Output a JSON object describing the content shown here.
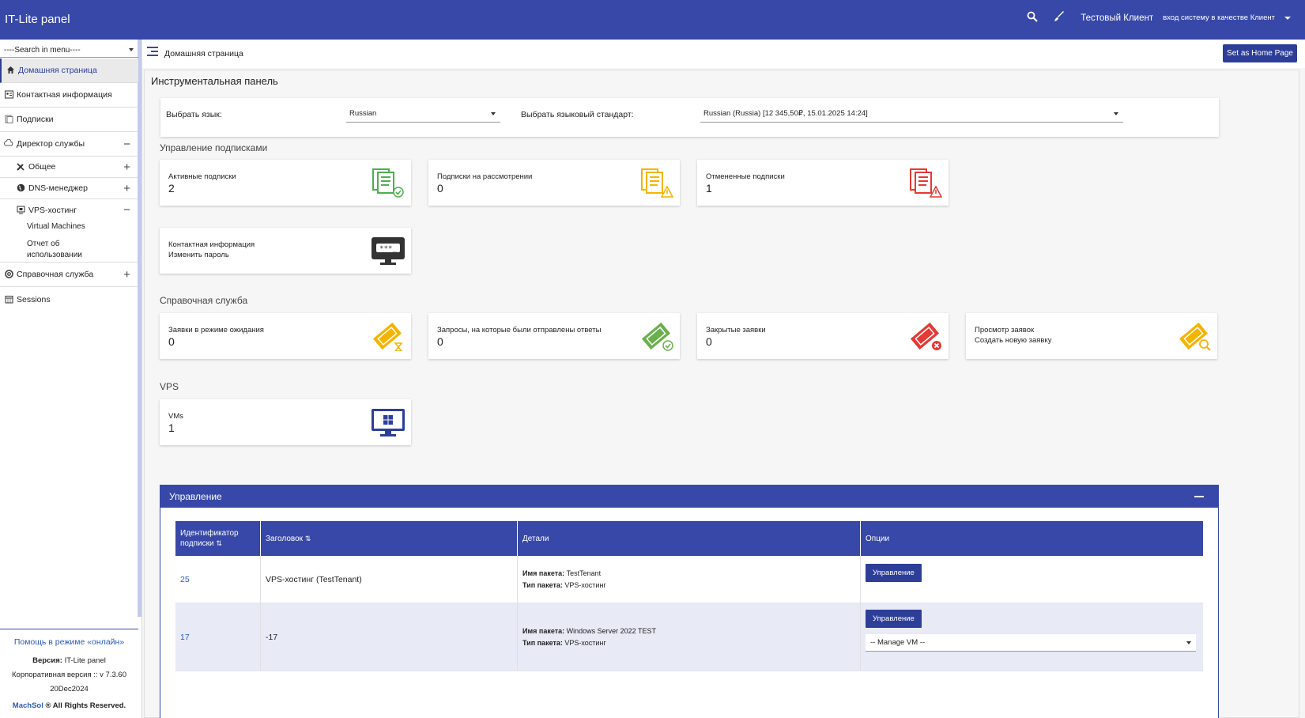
{
  "header": {
    "brand": "IT-Lite panel",
    "user_name": "Тестовый Клиент",
    "login_as": "вход систему в качестве Клиент",
    "icons": [
      "search-icon",
      "brush-icon",
      "chevron-down-icon"
    ]
  },
  "sidebar": {
    "search_placeholder": "----Search in menu----",
    "items": [
      {
        "label": "Домашняя страница",
        "icon": "home-icon"
      },
      {
        "label": "Контактная информация",
        "icon": "contact-card-icon"
      },
      {
        "label": "Подписки",
        "icon": "subscriptions-icon"
      },
      {
        "label": "Директор службы",
        "icon": "cloud-icon",
        "toggle": "−"
      },
      {
        "label": "Общее",
        "icon": "tools-icon",
        "toggle": "+"
      },
      {
        "label": "DNS-менеджер",
        "icon": "globe-icon",
        "toggle": "+"
      },
      {
        "label": "VPS-хостинг",
        "icon": "monitor-icon",
        "toggle": "−"
      },
      {
        "label": "Справочная служба",
        "icon": "lifebuoy-icon",
        "toggle": "+"
      },
      {
        "label": "Sessions",
        "icon": "calendar-icon"
      }
    ],
    "vps_children": [
      "Virtual Machines",
      "Отчет об использовании"
    ],
    "help_link": "Помощь в режиме «онлайн»",
    "version_label": "Версия:",
    "version_product": "IT-Lite panel",
    "version_line2": "Корпоративная версия :: v 7.3.60",
    "version_date": "20Dec2024",
    "copyright_brand": "MachSol",
    "copyright_text": "® All Rights Reserved."
  },
  "breadcrumb": {
    "current": "Домашняя страница",
    "home_button": "Set as Home Page"
  },
  "dashboard": {
    "title": "Инструментальная панель",
    "lang_label": "Выбрать язык:",
    "lang_value": "Russian",
    "locale_label": "Выбрать языковый стандарт:",
    "locale_value": "Russian (Russia) [12 345,50₽, 15.01.2025 14:24]",
    "subscriptions_section": "Управление подписками",
    "subscriptions": [
      {
        "title": "Активные подписки",
        "value": "2",
        "color": "#4caf50"
      },
      {
        "title": "Подписки на рассмотрении",
        "value": "0",
        "color": "#f5b400"
      },
      {
        "title": "Отмененные подписки",
        "value": "1",
        "color": "#e53935"
      }
    ],
    "contact_card": {
      "line1": "Контактная информация",
      "line2": "Изменить пароль"
    },
    "helpdesk_section": "Справочная служба",
    "helpdesk": [
      {
        "title": "Заявки в режиме ожидания",
        "value": "0",
        "color": "#f5b400"
      },
      {
        "title": "Запросы, на которые были отправлены ответы",
        "value": "0",
        "color": "#6ab04c"
      },
      {
        "title": "Закрытые заявки",
        "value": "0",
        "color": "#e53935"
      }
    ],
    "helpdesk_view": {
      "line1": "Просмотр заявок",
      "line2": "Создать новую заявку"
    },
    "vps_section": "VPS",
    "vms": {
      "title": "VMs",
      "value": "1"
    }
  },
  "management": {
    "title": "Управление",
    "columns": [
      "Идентификатор подписки",
      "Заголовок",
      "Детали",
      "Опции"
    ],
    "sort_glyph": "⇅",
    "pkg_name_label": "Имя пакета:",
    "pkg_type_label": "Тип пакета:",
    "rows": [
      {
        "id": "25",
        "title": "VPS-хостинг (TestTenant)",
        "pkg_name": "TestTenant",
        "pkg_type": "VPS-хостинг",
        "button": "Управление"
      },
      {
        "id": "17",
        "title": "-17",
        "pkg_name": "Windows Server 2022 TEST",
        "pkg_type": "VPS-хостинг",
        "button": "Управление",
        "select": "-- Manage VM --"
      }
    ]
  }
}
